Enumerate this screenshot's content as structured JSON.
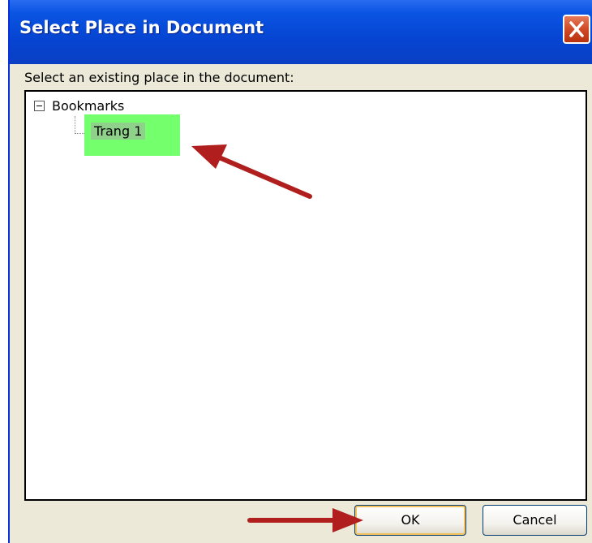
{
  "dialog": {
    "title": "Select Place in Document",
    "close_icon": "close-icon"
  },
  "prompt": "Select an existing place in the document:",
  "tree": {
    "root": {
      "label": "Bookmarks",
      "state": "expanded",
      "icon": "collapse-icon"
    },
    "children": [
      {
        "label": "Trang 1",
        "selected": true
      }
    ]
  },
  "buttons": {
    "ok": "OK",
    "cancel": "Cancel"
  },
  "annotations": {
    "color": "#b01e1e",
    "highlight_color": "#74ff6c"
  }
}
